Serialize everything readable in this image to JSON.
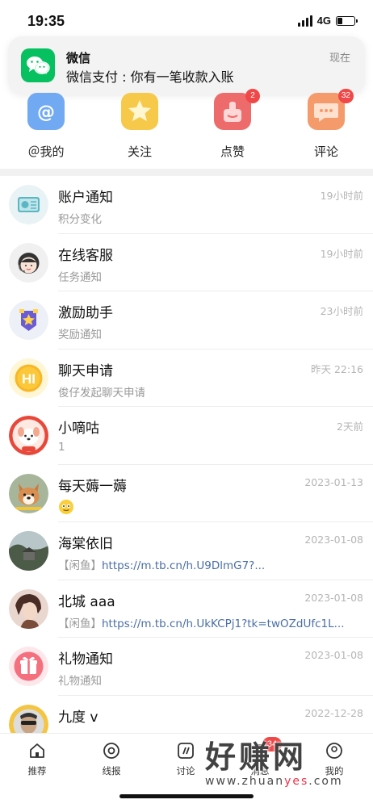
{
  "status_bar": {
    "time": "19:35",
    "network": "4G"
  },
  "notification": {
    "app": "微信",
    "message": "微信支付 : 你有一笔收款入账",
    "time": "现在"
  },
  "quick_actions": [
    {
      "label": "＠我的",
      "icon": "at-icon",
      "badge": ""
    },
    {
      "label": "关注",
      "icon": "star-icon",
      "badge": ""
    },
    {
      "label": "点赞",
      "icon": "like-icon",
      "badge": "2"
    },
    {
      "label": "评论",
      "icon": "comment-icon",
      "badge": "32"
    }
  ],
  "messages": [
    {
      "name": "账户通知",
      "subtitle": "积分变化",
      "time": "19小时前"
    },
    {
      "name": "在线客服",
      "subtitle": "任务通知",
      "time": "19小时前"
    },
    {
      "name": "激励助手",
      "subtitle": "奖励通知",
      "time": "23小时前"
    },
    {
      "name": "聊天申请",
      "subtitle": "俊仔发起聊天申请",
      "time": "昨天 22:16"
    },
    {
      "name": "小嘀咕",
      "subtitle": "1",
      "time": "2天前"
    },
    {
      "name": "每天薅一薅",
      "subtitle": "",
      "time": "2023-01-13"
    },
    {
      "name": "海棠依旧",
      "subtitle_prefix": "【闲鱼】",
      "subtitle_link": "https://m.tb.cn/h.U9DlmG7?...",
      "time": "2023-01-08"
    },
    {
      "name": "北城 aaa",
      "subtitle_prefix": "【闲鱼】",
      "subtitle_link": "https://m.tb.cn/h.UkKCPj1?tk=twOZdUfc1L...",
      "time": "2023-01-08"
    },
    {
      "name": "礼物通知",
      "subtitle": "礼物通知",
      "time": "2023-01-08"
    },
    {
      "name": "九度 v",
      "subtitle": "",
      "time": "2022-12-28"
    }
  ],
  "tabs": [
    {
      "label": "推荐",
      "icon": "home-icon"
    },
    {
      "label": "线报",
      "icon": "target-icon"
    },
    {
      "label": "讨论",
      "icon": "discuss-icon"
    },
    {
      "label": "消息",
      "icon": "message-icon",
      "badge": "34"
    },
    {
      "label": "我的",
      "icon": "profile-icon"
    }
  ],
  "watermark": {
    "big": "好赚网",
    "small_prefix": "www.zhuan",
    "small_accent": "yes",
    "small_suffix": ".com"
  }
}
